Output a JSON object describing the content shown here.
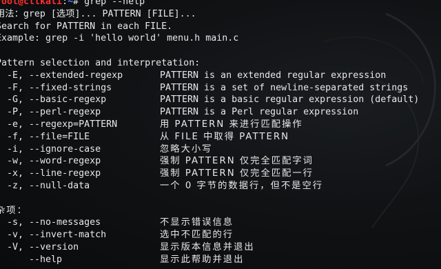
{
  "prompt": {
    "user_host": "root@cttkali",
    "separator": ":",
    "path": "~",
    "symbol": "# ",
    "command": "grep --help"
  },
  "header_lines": [
    "用法：grep [选项]... PATTERN [FILE]...",
    "Search for PATTERN in each FILE.",
    "Example: grep -i 'hello world' menu.h main.c"
  ],
  "section1_title": "Pattern selection and interpretation:",
  "section1_options": [
    {
      "opt": "  -E, --extended-regexp",
      "desc": "PATTERN is an extended regular expression"
    },
    {
      "opt": "  -F, --fixed-strings",
      "desc": "PATTERN is a set of newline-separated strings"
    },
    {
      "opt": "  -G, --basic-regexp",
      "desc": "PATTERN is a basic regular expression (default)"
    },
    {
      "opt": "  -P, --perl-regexp",
      "desc": "PATTERN is a Perl regular expression"
    },
    {
      "opt": "  -e, --regexp=PATTERN",
      "desc": "用 PATTERN 来进行匹配操作"
    },
    {
      "opt": "  -f, --file=FILE",
      "desc": "从 FILE 中取得 PATTERN"
    },
    {
      "opt": "  -i, --ignore-case",
      "desc": "忽略大小写"
    },
    {
      "opt": "  -w, --word-regexp",
      "desc": "强制 PATTERN 仅完全匹配字词"
    },
    {
      "opt": "  -x, --line-regexp",
      "desc": "强制 PATTERN 仅完全匹配一行"
    },
    {
      "opt": "  -z, --null-data",
      "desc": "一个 0 字节的数据行，但不是空行"
    }
  ],
  "section2_title": "杂项：",
  "section2_options": [
    {
      "opt": "  -s, --no-messages",
      "desc": "不显示错误信息"
    },
    {
      "opt": "  -v, --invert-match",
      "desc": "选中不匹配的行"
    },
    {
      "opt": "  -V, --version",
      "desc": "显示版本信息并退出"
    },
    {
      "opt": "      --help",
      "desc": "显示此帮助并退出"
    }
  ],
  "colors": {
    "user_host": "#ff2e2e",
    "path": "#4f86ff",
    "text": "#e8e8e8",
    "background": "#0b0d0f"
  }
}
